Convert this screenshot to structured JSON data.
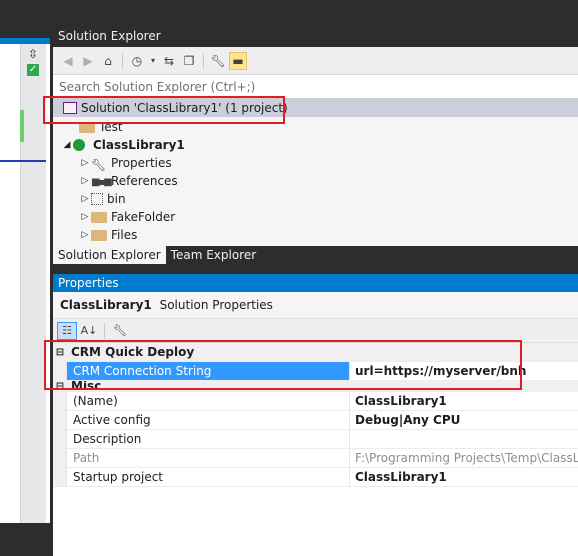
{
  "solution_explorer": {
    "title": "Solution Explorer",
    "search_placeholder": "Search Solution Explorer (Ctrl+;)",
    "toolbar_icons": [
      "back-icon",
      "forward-icon",
      "home-icon",
      "history-icon",
      "sync-icon",
      "collapse-all-icon",
      "properties-wrench-icon",
      "preview-pin-icon"
    ],
    "tree": {
      "solution_label": "Solution 'ClassLibrary1' (1 project)",
      "items": [
        {
          "label": "Test",
          "icon": "folder-icon"
        },
        {
          "label": "ClassLibrary1",
          "icon": "csharp-project-icon"
        },
        {
          "label": "Properties",
          "icon": "wrench-icon"
        },
        {
          "label": "References",
          "icon": "references-icon"
        },
        {
          "label": "bin",
          "icon": "hidden-folder-icon"
        },
        {
          "label": "FakeFolder",
          "icon": "folder-icon"
        },
        {
          "label": "Files",
          "icon": "folder-icon"
        }
      ]
    },
    "tabs": [
      "Solution Explorer",
      "Team Explorer"
    ]
  },
  "properties": {
    "title": "Properties",
    "object_name": "ClassLibrary1",
    "object_type": "Solution Properties",
    "categories": [
      {
        "name": "CRM Quick Deploy",
        "rows": [
          {
            "name": "CRM Connection String",
            "value": "url=https://myserver/bnh"
          }
        ]
      },
      {
        "name": "Misc",
        "rows": [
          {
            "name": "(Name)",
            "value": "ClassLibrary1"
          },
          {
            "name": "Active config",
            "value": "Debug|Any CPU"
          },
          {
            "name": "Description",
            "value": ""
          },
          {
            "name": "Path",
            "value": "F:\\Programming Projects\\Temp\\ClassLib"
          },
          {
            "name": "Startup project",
            "value": "ClassLibrary1"
          }
        ]
      }
    ]
  },
  "colors": {
    "accent": "#007acc",
    "selection": "#3399ff",
    "highlight_box": "#e31b23"
  }
}
